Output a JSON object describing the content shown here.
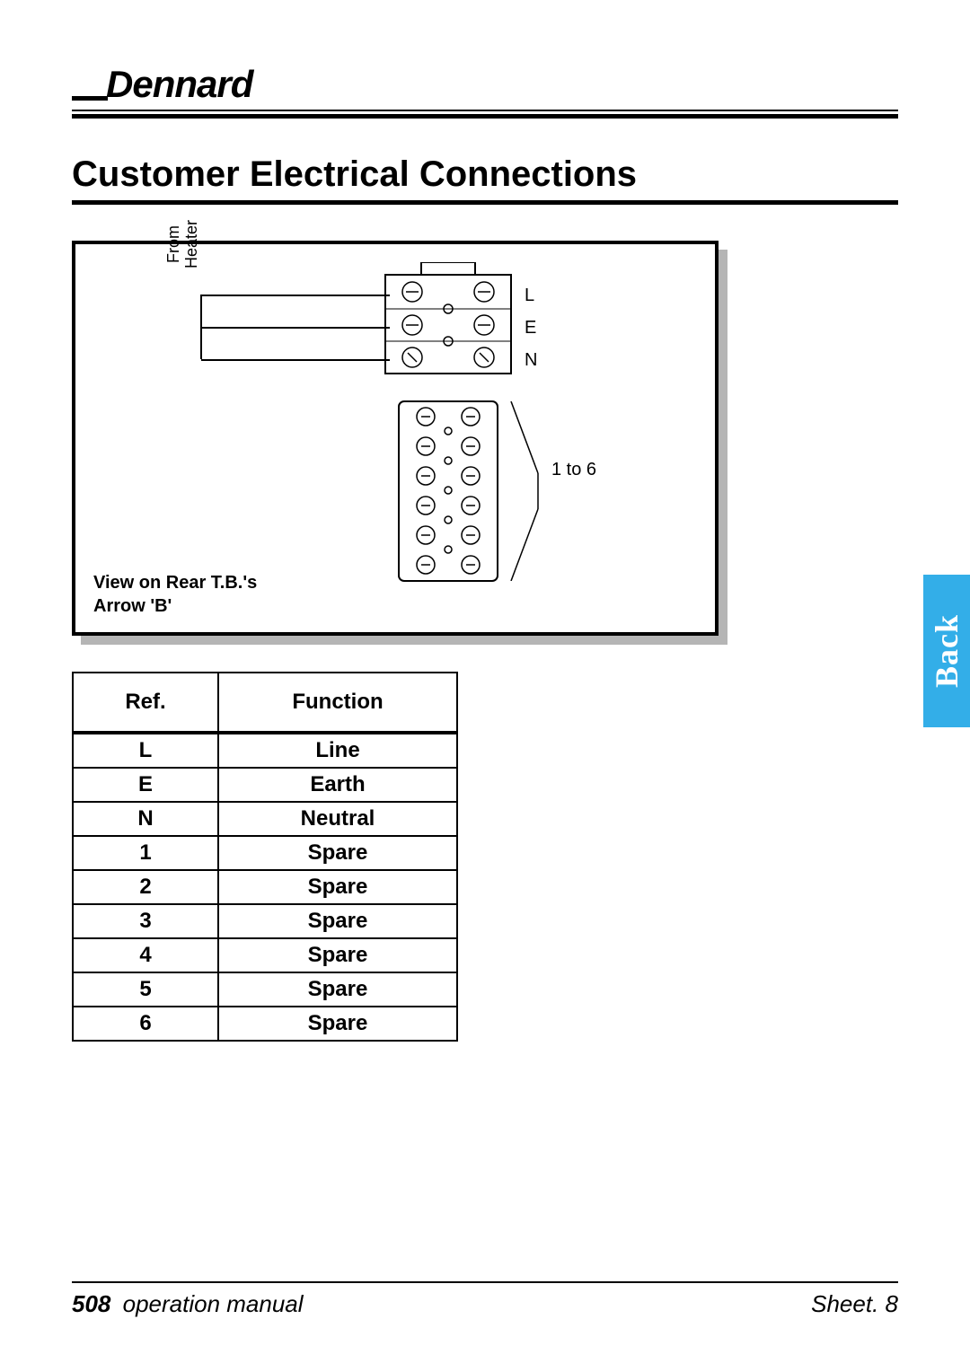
{
  "brand": "Dennard",
  "section_title": "Customer Electrical Connections",
  "diagram": {
    "from_heater_label": "From\nHeater",
    "labels": {
      "l": "L",
      "e": "E",
      "n": "N",
      "one_to_six": "1 to 6"
    },
    "note_line1": "View on Rear T.B.'s",
    "note_line2": "Arrow 'B'"
  },
  "table": {
    "headers": {
      "ref": "Ref.",
      "function": "Function"
    },
    "rows": [
      {
        "ref": "L",
        "function": "Line"
      },
      {
        "ref": "E",
        "function": "Earth"
      },
      {
        "ref": "N",
        "function": "Neutral"
      },
      {
        "ref": "1",
        "function": "Spare"
      },
      {
        "ref": "2",
        "function": "Spare"
      },
      {
        "ref": "3",
        "function": "Spare"
      },
      {
        "ref": "4",
        "function": "Spare"
      },
      {
        "ref": "5",
        "function": "Spare"
      },
      {
        "ref": "6",
        "function": "Spare"
      }
    ]
  },
  "back_tab": "Back",
  "footer": {
    "model": "508",
    "doc_type": "operation manual",
    "sheet_label": "Sheet.",
    "sheet_num": "8"
  }
}
